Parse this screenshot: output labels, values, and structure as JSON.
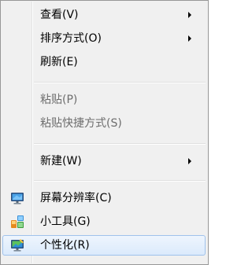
{
  "menu": {
    "items": [
      {
        "label": "查看(V)"
      },
      {
        "label": "排序方式(O)"
      },
      {
        "label": "刷新(E)"
      },
      {
        "label": "粘贴(P)"
      },
      {
        "label": "粘贴快捷方式(S)"
      },
      {
        "label": "新建(W)"
      },
      {
        "label": "屏幕分辨率(C)",
        "icon": "monitor-icon"
      },
      {
        "label": "小工具(G)",
        "icon": "gadgets-icon"
      },
      {
        "label": "个性化(R)",
        "icon": "personalize-icon"
      }
    ]
  },
  "colors": {
    "menu_background": "#f0f0f0",
    "disabled_text": "#6d6d6d",
    "hover_border": "#9fc2ec"
  }
}
